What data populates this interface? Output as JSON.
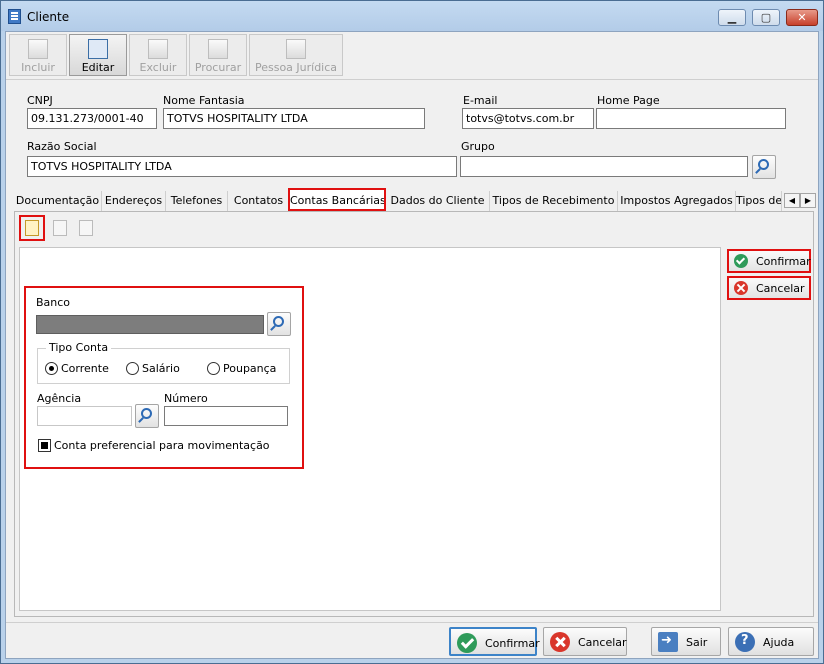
{
  "window": {
    "title": "Cliente"
  },
  "toolbar": [
    {
      "label": "Incluir",
      "enabled": false
    },
    {
      "label": "Editar",
      "enabled": true
    },
    {
      "label": "Excluir",
      "enabled": false
    },
    {
      "label": "Procurar",
      "enabled": false
    },
    {
      "label": "Pessoa Jurídica",
      "enabled": false
    }
  ],
  "header": {
    "cnpj_label": "CNPJ",
    "cnpj_value": "09.131.273/0001-40",
    "nome_fantasia_label": "Nome Fantasia",
    "nome_fantasia_value": "TOTVS HOSPITALITY LTDA",
    "email_label": "E-mail",
    "email_value": "totvs@totvs.com.br",
    "homepage_label": "Home Page",
    "homepage_value": "",
    "razao_social_label": "Razão Social",
    "razao_social_value": "TOTVS HOSPITALITY LTDA",
    "grupo_label": "Grupo",
    "grupo_value": ""
  },
  "tabs": [
    {
      "label": "Documentação"
    },
    {
      "label": "Endereços"
    },
    {
      "label": "Telefones"
    },
    {
      "label": "Contatos"
    },
    {
      "label": "Contas Bancárias",
      "selected": true
    },
    {
      "label": "Dados do Cliente"
    },
    {
      "label": "Tipos de Recebimento"
    },
    {
      "label": "Impostos Agregados"
    },
    {
      "label": "Tipos de"
    }
  ],
  "form": {
    "banco_label": "Banco",
    "banco_value": "",
    "tipo_conta_label": "Tipo Conta",
    "tipo_conta_options": [
      "Corrente",
      "Salário",
      "Poupança"
    ],
    "tipo_conta_selected": "Corrente",
    "agencia_label": "Agência",
    "agencia_value": "",
    "numero_label": "Número",
    "numero_value": "",
    "preferencial_label": "Conta preferencial para movimentação",
    "preferencial_checked": true
  },
  "side_buttons": {
    "confirm_label": "Confirmar",
    "cancel_label": "Cancelar"
  },
  "footer": {
    "confirm_label": "Confirmar",
    "cancel_label": "Cancelar",
    "exit_label": "Sair",
    "help_label": "Ajuda"
  },
  "colors": {
    "highlight": "#e01010",
    "window_frame": "#b9d1ea",
    "accent": "#2d6ab5"
  }
}
